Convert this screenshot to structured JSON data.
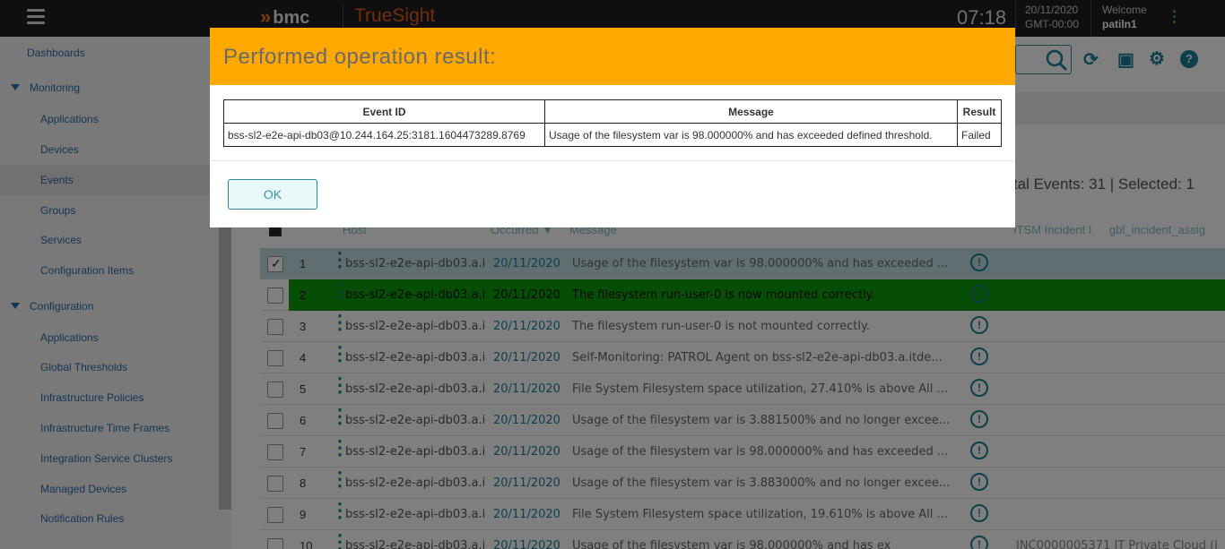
{
  "topbar": {
    "brand": "bmc",
    "product": "TrueSight",
    "time": "07:18",
    "date": "20/11/2020",
    "timezone": "GMT-00:00",
    "welcome": "Welcome",
    "user": "patiln1"
  },
  "sidebar": {
    "top_item": "Dashboards",
    "monitoring_label": "Monitoring",
    "monitoring_items": [
      "Applications",
      "Devices",
      "Events",
      "Groups",
      "Services",
      "Configuration Items"
    ],
    "configuration_label": "Configuration",
    "configuration_items": [
      "Applications",
      "Global Thresholds",
      "Infrastructure Policies",
      "Infrastructure Time Frames",
      "Integration Service Clusters",
      "Managed Devices",
      "Notification Rules"
    ]
  },
  "events": {
    "totals": "tal Events: 31 | Selected: 1",
    "headers": {
      "host": "Host",
      "occurred": "Occurred",
      "message": "Message",
      "itsm": "ITSM Incident I",
      "gbl": "gbl_incident_assig"
    },
    "rows": [
      {
        "num": "1",
        "host": "bss-sl2-e2e-api-db03.a.i",
        "date": "20/11/2020",
        "message": "Usage of the filesystem var is 98.000000% and has exceeded ..."
      },
      {
        "num": "2",
        "host": "bss-sl2-e2e-api-db03.a.i",
        "date": "20/11/2020",
        "message": "The filesystem run-user-0 is now mounted correctly."
      },
      {
        "num": "3",
        "host": "bss-sl2-e2e-api-db03.a.i",
        "date": "20/11/2020",
        "message": "The filesystem run-user-0 is not mounted correctly."
      },
      {
        "num": "4",
        "host": "bss-sl2-e2e-api-db03.a.i",
        "date": "20/11/2020",
        "message": "Self-Monitoring: PATROL Agent on bss-sl2-e2e-api-db03.a.itde..."
      },
      {
        "num": "5",
        "host": "bss-sl2-e2e-api-db03.a.i",
        "date": "20/11/2020",
        "message": "File System Filesystem space utilization, 27.410% is above All ..."
      },
      {
        "num": "6",
        "host": "bss-sl2-e2e-api-db03.a.i",
        "date": "20/11/2020",
        "message": "Usage of the filesystem var is 3.881500% and no longer excee..."
      },
      {
        "num": "7",
        "host": "bss-sl2-e2e-api-db03.a.i",
        "date": "20/11/2020",
        "message": "Usage of the filesystem var is 98.000000% and has exceeded ..."
      },
      {
        "num": "8",
        "host": "bss-sl2-e2e-api-db03.a.i",
        "date": "20/11/2020",
        "message": "Usage of the filesystem var is 3.883000% and no longer excee..."
      },
      {
        "num": "9",
        "host": "bss-sl2-e2e-api-db03.a.i",
        "date": "20/11/2020",
        "message": "File System Filesystem space utilization, 19.610% is above All ..."
      },
      {
        "num": "10",
        "host": "bss-sl2-e2e-api-db03.a.i",
        "date": "20/11/2020",
        "message": "Usage of the filesystem var is 98.000000% and has ex",
        "extra": "INC0000005371 IT Private Cloud (I"
      }
    ]
  },
  "modal": {
    "title": "Performed operation result:",
    "columns": [
      "Event ID",
      "Message",
      "Result"
    ],
    "result_row": {
      "event_id": "bss-sl2-e2e-api-db03@10.244.164.25:3181.1604473289.8769",
      "message": "Usage of the filesystem var is 98.000000% and has exceeded defined threshold.",
      "result": "Failed"
    },
    "ok_label": "OK"
  },
  "colors": {
    "modal_header": "#ffa800",
    "accent": "#1a7f96",
    "selected_row": "#c3dde3",
    "green_row": "#0c9a0c"
  }
}
